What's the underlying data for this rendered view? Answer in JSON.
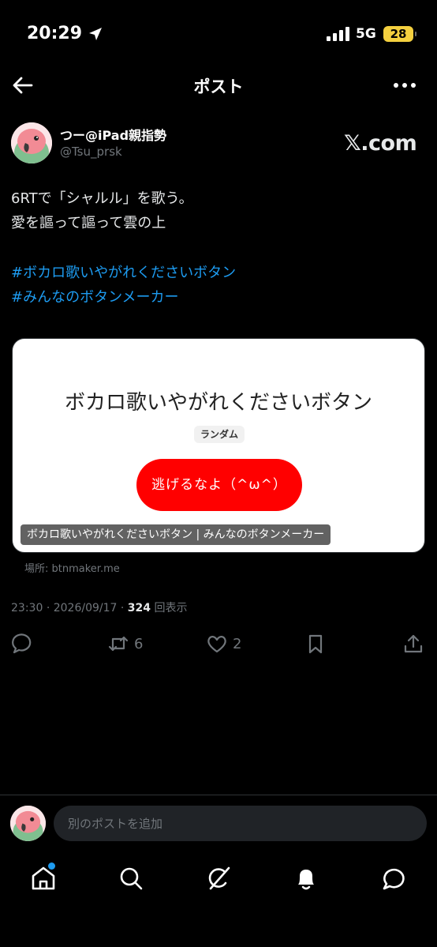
{
  "status": {
    "time": "20:29",
    "network": "5G",
    "battery": "28"
  },
  "header": {
    "title": "ポスト"
  },
  "author": {
    "display_name": "つー@iPad親指勢",
    "handle": "@Tsu_prsk",
    "source_logo": "𝕏.com"
  },
  "tweet": {
    "lines": [
      "6RTで「シャルル」を歌う。",
      "愛を謳って謳って雲の上"
    ],
    "hashtags": [
      "#ボカロ歌いやがれくださいボタン",
      "#みんなのボタンメーカー"
    ]
  },
  "card": {
    "headline": "ボカロ歌いやがれくださいボタン",
    "chip": "ランダム",
    "button": "逃げるなよ（^ω^）",
    "caption": "ボカロ歌いやがれくださいボタン | みんなのボタンメーカー",
    "source": "場所: btnmaker.me"
  },
  "meta": {
    "time": "23:30",
    "date": "2026/09/17",
    "views": "324",
    "views_label": "回表示"
  },
  "actions": {
    "retweets": "6",
    "likes": "2"
  },
  "reply": {
    "placeholder": "別のポストを追加"
  },
  "icons": [
    "location-arrow-icon",
    "signal-icon",
    "back-arrow-icon",
    "more-icon",
    "reply-icon",
    "retweet-icon",
    "like-icon",
    "bookmark-icon",
    "share-icon",
    "home-icon",
    "search-icon",
    "grok-icon",
    "bell-icon",
    "messages-icon"
  ],
  "colors": {
    "accent": "#1d9bf0",
    "card_button": "#ff0000",
    "battery": "#f4d03f"
  }
}
